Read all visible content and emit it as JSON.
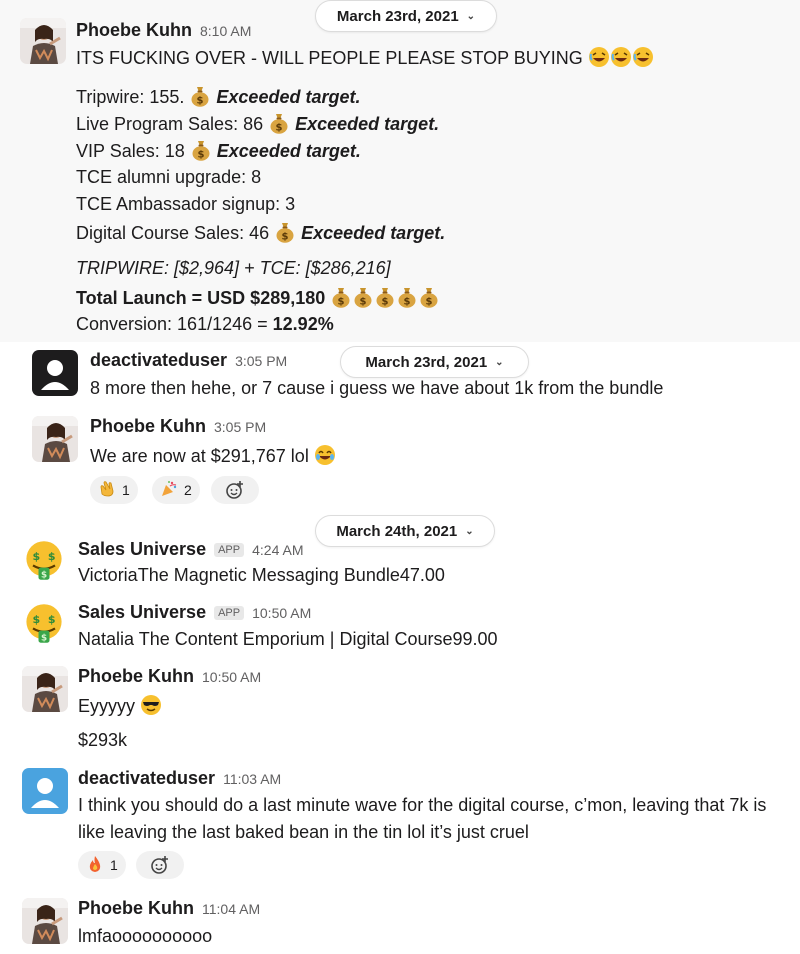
{
  "toolbar": {
    "icons": [
      "add-reaction-icon",
      "reply-thread-icon",
      "share-icon",
      "bookmark-icon",
      "more-actions-icon",
      "kebab-icon"
    ]
  },
  "date_dividers": [
    {
      "label": "March 23rd, 2021"
    },
    {
      "label": "March 23rd, 2021"
    },
    {
      "label": "March 24th, 2021"
    }
  ],
  "messages": {
    "m1": {
      "name": "Phoebe Kuhn",
      "time": "8:10 AM",
      "headline": "ITS FUCKING OVER - WILL PEOPLE PLEASE STOP BUYING",
      "stats": [
        {
          "label": "Tripwire: 155.",
          "note": "Exceeded target."
        },
        {
          "label": "Live Program Sales: 86",
          "note": "Exceeded target."
        },
        {
          "label": "VIP Sales: 18",
          "note": "Exceeded target."
        },
        {
          "label": "TCE alumni upgrade: 8",
          "note": ""
        },
        {
          "label": "TCE Ambassador signup: 3",
          "note": ""
        },
        {
          "label": "Digital Course Sales: 46",
          "note": "Exceeded target."
        }
      ],
      "summary_italic": "TRIPWIRE: [$2,964] + TCE: [$286,216]",
      "total": "Total Launch = USD $289,180",
      "conversion_label": "Conversion: 161/1246 =",
      "conversion_value": "12.92%"
    },
    "m2": {
      "name": "deactivateduser",
      "time": "3:05 PM",
      "text": "8 more then hehe, or 7 cause i guess we have about 1k from the bundle"
    },
    "m3": {
      "name": "Phoebe Kuhn",
      "time": "3:05 PM",
      "text": "We are now at $291,767 lol",
      "reactions": [
        {
          "emoji": "clapping-hands-icon",
          "count": "1"
        },
        {
          "emoji": "party-popper-icon",
          "count": "2"
        }
      ]
    },
    "m4": {
      "name": "Sales Universe",
      "badge": "APP",
      "time": "4:24 AM",
      "text": "VictoriaThe Magnetic Messaging Bundle47.00"
    },
    "m5": {
      "name": "Sales Universe",
      "badge": "APP",
      "time": "10:50 AM",
      "text": "Natalia The Content Emporium | Digital Course99.00"
    },
    "m6": {
      "name": "Phoebe Kuhn",
      "time": "10:50 AM",
      "text": "Eyyyyy",
      "text2": "$293k"
    },
    "m7": {
      "name": "deactivateduser",
      "time": "11:03 AM",
      "text": "I think you should do a last minute wave for the digital course, c’mon, leaving that 7k is",
      "text2": "like leaving the last baked bean in the tin lol it’s just cruel",
      "reactions": [
        {
          "emoji": "fire-icon",
          "count": "1"
        }
      ]
    },
    "m8": {
      "name": "Phoebe Kuhn",
      "time": "11:04 AM",
      "text": "lmfaoooooooooo"
    }
  },
  "colors": {
    "name": "#1d1c1d",
    "time": "#616061",
    "highlight_bg": "#f8f8f8",
    "reaction_bg": "#f1f1f1",
    "default_avatar": "#4aa3df"
  }
}
